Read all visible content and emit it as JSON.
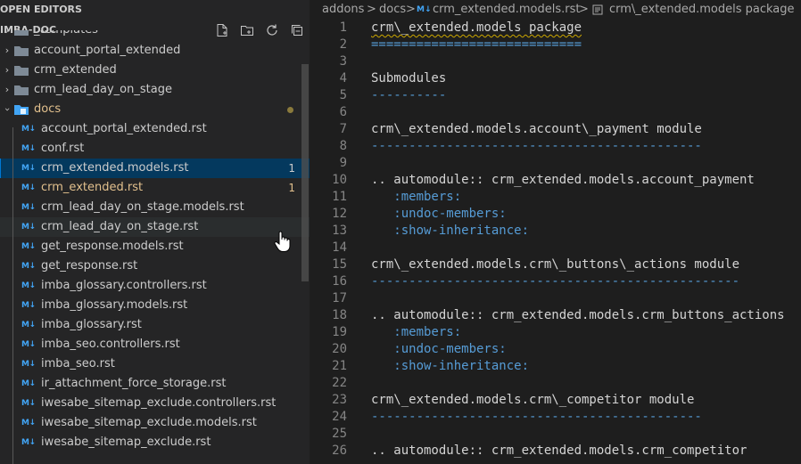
{
  "explorer": {
    "open_editors_label": "OPEN EDITORS",
    "workspace_label": "IMBA-DOC",
    "actions": [
      "new-file-icon",
      "new-folder-icon",
      "refresh-icon",
      "collapse-all-icon"
    ],
    "tree": [
      {
        "label": "_templates",
        "kind": "folder",
        "expanded": false
      },
      {
        "label": "account_portal_extended",
        "kind": "folder",
        "expanded": false
      },
      {
        "label": "crm_extended",
        "kind": "folder",
        "expanded": false
      },
      {
        "label": "crm_lead_day_on_stage",
        "kind": "folder",
        "expanded": false
      },
      {
        "label": "docs",
        "kind": "folder",
        "expanded": true
      },
      {
        "label": "account_portal_extended.rst",
        "kind": "file"
      },
      {
        "label": "conf.rst",
        "kind": "file"
      },
      {
        "label": "crm_extended.models.rst",
        "kind": "file",
        "badge": "1",
        "selected": true
      },
      {
        "label": "crm_extended.rst",
        "kind": "file",
        "badge": "1",
        "modified": true
      },
      {
        "label": "crm_lead_day_on_stage.models.rst",
        "kind": "file"
      },
      {
        "label": "crm_lead_day_on_stage.rst",
        "kind": "file",
        "hovered": true
      },
      {
        "label": "get_response.models.rst",
        "kind": "file"
      },
      {
        "label": "get_response.rst",
        "kind": "file"
      },
      {
        "label": "imba_glossary.controllers.rst",
        "kind": "file"
      },
      {
        "label": "imba_glossary.models.rst",
        "kind": "file"
      },
      {
        "label": "imba_glossary.rst",
        "kind": "file"
      },
      {
        "label": "imba_seo.controllers.rst",
        "kind": "file"
      },
      {
        "label": "imba_seo.rst",
        "kind": "file"
      },
      {
        "label": "ir_attachment_force_storage.rst",
        "kind": "file"
      },
      {
        "label": "iwesabe_sitemap_exclude.controllers.rst",
        "kind": "file"
      },
      {
        "label": "iwesabe_sitemap_exclude.models.rst",
        "kind": "file"
      },
      {
        "label": "iwesabe_sitemap_exclude.rst",
        "kind": "file"
      }
    ],
    "file_icon_text": "M↓"
  },
  "breadcrumb": {
    "items": [
      "addons",
      "docs",
      "crm_extended.models.rst",
      "crm\\_extended.models package"
    ],
    "separator": ">"
  },
  "editor": {
    "lines": [
      {
        "n": "1",
        "text": "crm\\_extended.models package",
        "style": "heading"
      },
      {
        "n": "2",
        "text": "============================",
        "style": "sep"
      },
      {
        "n": "3",
        "text": "",
        "style": "text"
      },
      {
        "n": "4",
        "text": "Submodules",
        "style": "text"
      },
      {
        "n": "5",
        "text": "----------",
        "style": "sep"
      },
      {
        "n": "6",
        "text": "",
        "style": "text"
      },
      {
        "n": "7",
        "text": "crm\\_extended.models.account\\_payment module",
        "style": "text"
      },
      {
        "n": "8",
        "text": "--------------------------------------------",
        "style": "sep"
      },
      {
        "n": "9",
        "text": "",
        "style": "text"
      },
      {
        "n": "10",
        "text": ".. automodule:: crm_extended.models.account_payment",
        "style": "text"
      },
      {
        "n": "11",
        "text": "   :members:",
        "style": "opt"
      },
      {
        "n": "12",
        "text": "   :undoc-members:",
        "style": "opt"
      },
      {
        "n": "13",
        "text": "   :show-inheritance:",
        "style": "opt"
      },
      {
        "n": "14",
        "text": "",
        "style": "text"
      },
      {
        "n": "15",
        "text": "crm\\_extended.models.crm\\_buttons\\_actions module",
        "style": "text"
      },
      {
        "n": "16",
        "text": "-------------------------------------------------",
        "style": "sep"
      },
      {
        "n": "17",
        "text": "",
        "style": "text"
      },
      {
        "n": "18",
        "text": ".. automodule:: crm_extended.models.crm_buttons_actions",
        "style": "text"
      },
      {
        "n": "19",
        "text": "   :members:",
        "style": "opt"
      },
      {
        "n": "20",
        "text": "   :undoc-members:",
        "style": "opt"
      },
      {
        "n": "21",
        "text": "   :show-inheritance:",
        "style": "opt"
      },
      {
        "n": "22",
        "text": "",
        "style": "text"
      },
      {
        "n": "23",
        "text": "crm\\_extended.models.crm\\_competitor module",
        "style": "text"
      },
      {
        "n": "24",
        "text": "--------------------------------------------",
        "style": "sep"
      },
      {
        "n": "25",
        "text": "",
        "style": "text"
      },
      {
        "n": "26",
        "text": ".. automodule:: crm_extended.models.crm_competitor",
        "style": "text"
      }
    ]
  },
  "colors": {
    "sidebar_bg": "#252526",
    "editor_bg": "#1e1e1e",
    "selection_bg": "#04395e",
    "modified_text": "#e2c08d",
    "rst_separator": "#569cd6",
    "rst_option": "#569cd6"
  }
}
